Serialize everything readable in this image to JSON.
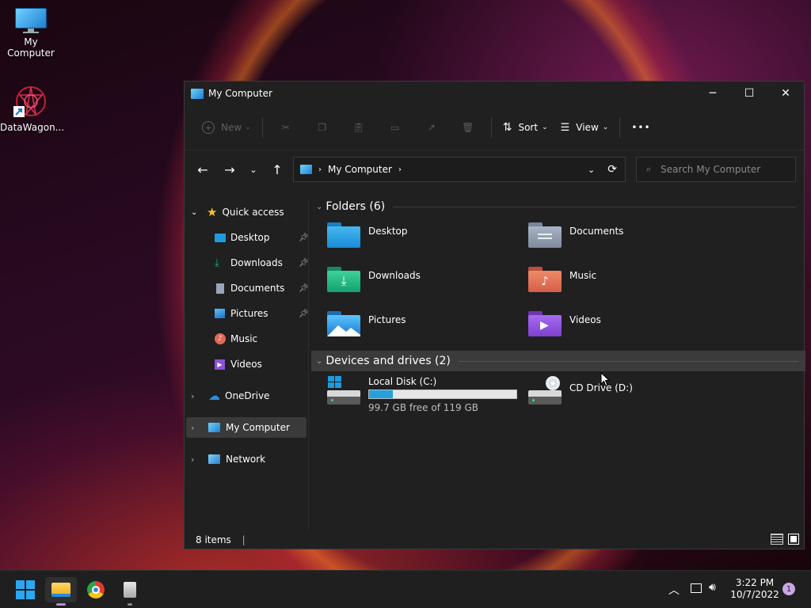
{
  "desktop": {
    "icons": [
      {
        "label": "My Computer",
        "icon": "monitor-icon"
      },
      {
        "label": "DataWagon...",
        "icon": "datawagon-shortcut-icon"
      }
    ]
  },
  "window": {
    "title": "My Computer",
    "controls": {
      "minimize": "─",
      "maximize": "☐",
      "close": "✕"
    }
  },
  "toolbar": {
    "new_label": "New",
    "sort_label": "Sort",
    "view_label": "View",
    "more_label": "•••"
  },
  "address": {
    "path": "My Computer",
    "search_placeholder": "Search My Computer"
  },
  "sidebar": {
    "quick_access": "Quick access",
    "items": [
      {
        "label": "Desktop",
        "pinned": true
      },
      {
        "label": "Downloads",
        "pinned": true
      },
      {
        "label": "Documents",
        "pinned": true
      },
      {
        "label": "Pictures",
        "pinned": true
      },
      {
        "label": "Music",
        "pinned": false
      },
      {
        "label": "Videos",
        "pinned": false
      }
    ],
    "onedrive": "OneDrive",
    "my_computer": "My Computer",
    "network": "Network"
  },
  "folders": {
    "header": "Folders (6)",
    "items": [
      {
        "label": "Desktop",
        "color": "#1e9be0"
      },
      {
        "label": "Documents",
        "color": "#8a96a8"
      },
      {
        "label": "Downloads",
        "color": "#22b07d"
      },
      {
        "label": "Music",
        "color": "#e0714f"
      },
      {
        "label": "Pictures",
        "color": "#2a8ad8"
      },
      {
        "label": "Videos",
        "color": "#8f4fd8"
      }
    ]
  },
  "drives": {
    "header": "Devices and drives (2)",
    "local": {
      "label": "Local Disk (C:)",
      "free": "99.7 GB free of 119 GB",
      "used_fraction": 0.16
    },
    "cd": {
      "label": "CD Drive (D:)"
    }
  },
  "status": {
    "items": "8 items"
  },
  "taskbar": {
    "time": "3:22 PM",
    "date": "10/7/2022",
    "notification_count": "1"
  },
  "colors": {
    "accent": "#1e9be0",
    "selected_bg": "#3a3a3a"
  }
}
